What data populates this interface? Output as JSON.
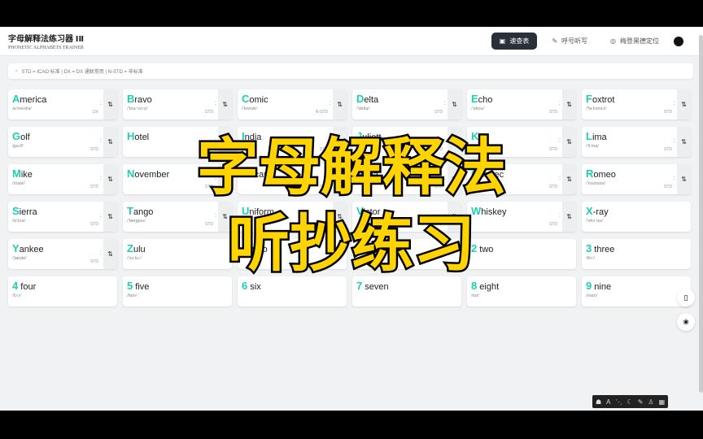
{
  "header": {
    "title": "字母解释法练习器 ⅠⅡ",
    "subtitle": "PHONETIC ALPHABETS TRAINER",
    "nav": [
      {
        "label": "速查表",
        "icon": "table-icon",
        "active": true
      },
      {
        "label": "呼号听写",
        "icon": "pencil-icon"
      },
      {
        "label": "梅登黑德定位",
        "icon": "target-icon"
      }
    ],
    "github_icon": "github-icon"
  },
  "info": "STD = ICAO 标准 | DX = DX 通联常用 | N-STD = 非标准",
  "accent": "#1ccfb0",
  "cards": [
    {
      "w": "America",
      "p": "/a'merika/",
      "t": "DX",
      "sw": true
    },
    {
      "w": "Bravo",
      "p": "/'bra:'vo:o/",
      "t": "STD",
      "sw": true
    },
    {
      "w": "Comic",
      "p": "/'komɪk/",
      "t": "N-STD",
      "sw": true
    },
    {
      "w": "Delta",
      "p": "/'delta/",
      "t": "STD",
      "sw": true
    },
    {
      "w": "Echo",
      "p": "/'ekou/",
      "t": "STD",
      "sw": true
    },
    {
      "w": "Foxtrot",
      "p": "/'fa:kstra:t/",
      "t": "STD",
      "sw": true
    },
    {
      "w": "Golf",
      "p": "/ga:lf/",
      "t": "STD",
      "sw": true
    },
    {
      "w": "Hotel",
      "p": "",
      "t": "STD",
      "sw": true
    },
    {
      "w": "India",
      "p": "",
      "t": "STD",
      "sw": true
    },
    {
      "w": "Juliett",
      "p": "",
      "t": "STD",
      "sw": true
    },
    {
      "w": "Kilo",
      "p": "",
      "t": "STD",
      "sw": true
    },
    {
      "w": "Lima",
      "p": "/'li:ma/",
      "t": "STD",
      "sw": true
    },
    {
      "w": "Mike",
      "p": "/maɪk/",
      "t": "STD",
      "sw": true
    },
    {
      "w": "November",
      "p": "",
      "t": "STD",
      "sw": true
    },
    {
      "w": "Oscar",
      "p": "",
      "t": "STD",
      "sw": true
    },
    {
      "w": "Papa",
      "p": "",
      "t": "STD",
      "sw": true
    },
    {
      "w": "Quebec",
      "p": "",
      "t": "STD",
      "sw": true
    },
    {
      "w": "Romeo",
      "p": "/'roumiou/",
      "t": "STD",
      "sw": true
    },
    {
      "w": "Sierra",
      "p": "/si'era/",
      "t": "STD",
      "sw": true
    },
    {
      "w": "Tango",
      "p": "/'tæŋgou/",
      "t": "STD",
      "sw": true
    },
    {
      "w": "Uniform",
      "p": "",
      "t": "STD",
      "sw": true
    },
    {
      "w": "Victor",
      "p": "",
      "t": "STD",
      "sw": true
    },
    {
      "w": "Whiskey",
      "p": "",
      "t": "STD",
      "sw": true
    },
    {
      "w": "X-ray",
      "p": "/'eks reɪ/",
      "t": "",
      "sw": false
    },
    {
      "w": "Yankee",
      "p": "/'jæŋki/",
      "t": "STD",
      "sw": true
    },
    {
      "w": "Zulu",
      "p": "/'zu:lu:/",
      "t": "",
      "sw": false
    },
    {
      "w": "0 zero",
      "p": "",
      "t": "",
      "sw": false
    },
    {
      "w": "1 one",
      "p": "",
      "t": "",
      "sw": false
    },
    {
      "w": "2 two",
      "p": "",
      "t": "",
      "sw": false
    },
    {
      "w": "3 three",
      "p": "/θri:/",
      "t": "",
      "sw": false
    },
    {
      "w": "4 four",
      "p": "/fɔ:r/",
      "t": "",
      "sw": false
    },
    {
      "w": "5 five",
      "p": "/faɪv/",
      "t": "",
      "sw": false
    },
    {
      "w": "6 six",
      "p": "",
      "t": "",
      "sw": false
    },
    {
      "w": "7 seven",
      "p": "",
      "t": "",
      "sw": false
    },
    {
      "w": "8 eight",
      "p": "/eɪt/",
      "t": "",
      "sw": false
    },
    {
      "w": "9 nine",
      "p": "/naɪn/",
      "t": "",
      "sw": false
    }
  ],
  "overlay": {
    "line1": "字母解释法",
    "line2": "听抄练习"
  }
}
